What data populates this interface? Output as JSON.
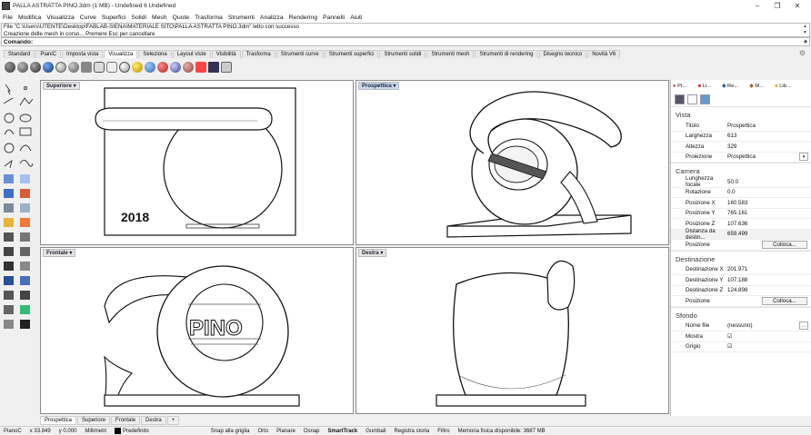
{
  "window": {
    "title": "PALLA ASTRATTA PINO.3dm (1 MB) - Undefined 6 Undefined",
    "controls": [
      "–",
      "❐",
      "✕"
    ]
  },
  "menu": [
    "File",
    "Modifica",
    "Visualizza",
    "Curve",
    "Superfici",
    "Solidi",
    "Mesh",
    "Quote",
    "Trasforma",
    "Strumenti",
    "Analizza",
    "Rendering",
    "Pannelli",
    "Aiuti"
  ],
  "command_history": [
    "File \"C:\\Users\\UTENTE\\Desktop\\FABLAB-SIENA\\MATERIALE SITO\\PALLA ASTRATTA PINO.3dm\" letto con successo",
    "Creazione delle mesh in corso... Premere Esc per cancellare"
  ],
  "command_prompt": "Comando:",
  "toolbar_tabs": [
    "Standard",
    "PianiC",
    "Imposta vista",
    "Visualizza",
    "Seleziona",
    "Layout viste",
    "Visibilità",
    "Trasforma",
    "Strumenti curve",
    "Strumenti superfici",
    "Strumenti solidi",
    "Strumenti mesh",
    "Strumenti di rendering",
    "Disegno tecnico",
    "Novità V6"
  ],
  "active_toolbar_tab": "Visualizza",
  "viewports": {
    "top": {
      "label": "Superiore",
      "year_text": "2018"
    },
    "perspective": {
      "label": "Prospettica"
    },
    "front": {
      "label": "Frontale",
      "name_text": "PINO"
    },
    "right": {
      "label": "Destra"
    }
  },
  "viewport_tabs": [
    "Prospettica",
    "Superiore",
    "Frontale",
    "Destra",
    "+"
  ],
  "panel": {
    "tabs": [
      "Pr...",
      "Li...",
      "Re...",
      "M...",
      "Lib..."
    ],
    "sections": {
      "vista": {
        "title": "Vista",
        "rows": [
          {
            "label": "Titolo",
            "value": "Prospettica"
          },
          {
            "label": "Larghezza",
            "value": "613"
          },
          {
            "label": "Altezza",
            "value": "329"
          },
          {
            "label": "Proiezione",
            "value": "Prospettica"
          }
        ]
      },
      "camera": {
        "title": "Camera",
        "rows": [
          {
            "label": "Lunghezza focale",
            "value": "50.0"
          },
          {
            "label": "Rotazione",
            "value": "0.0"
          },
          {
            "label": "Posizione X",
            "value": "160.583"
          },
          {
            "label": "Posizione Y",
            "value": "765.161"
          },
          {
            "label": "Posizione Z",
            "value": "107.636"
          },
          {
            "label": "Distanza da destin...",
            "value": "659.499"
          },
          {
            "label": "Posizione",
            "value": "Colloca..."
          }
        ]
      },
      "destinazione": {
        "title": "Destinazione",
        "rows": [
          {
            "label": "Destinazione X",
            "value": "201.971"
          },
          {
            "label": "Destinazione Y",
            "value": "107.188"
          },
          {
            "label": "Destinazione Z",
            "value": "124.898"
          },
          {
            "label": "Posizione",
            "value": "Colloca..."
          }
        ]
      },
      "sfondo": {
        "title": "Sfondo",
        "rows": [
          {
            "label": "Nome file",
            "value": "(nessuno)"
          },
          {
            "label": "Mostra",
            "value": "☑"
          },
          {
            "label": "Grigio",
            "value": "☑"
          }
        ]
      }
    }
  },
  "status": {
    "cplane": "PianoC",
    "x": "x 33.849",
    "y": "y 0.000",
    "units": "Millimetri",
    "layer": "Predefinito",
    "items": [
      "Snap alla griglia",
      "Orto",
      "Planare",
      "Osnap",
      "SmartTrack",
      "Gumball",
      "Registra storia",
      "Filtro",
      "Memoria fisica disponibile: 3687 MB"
    ]
  }
}
